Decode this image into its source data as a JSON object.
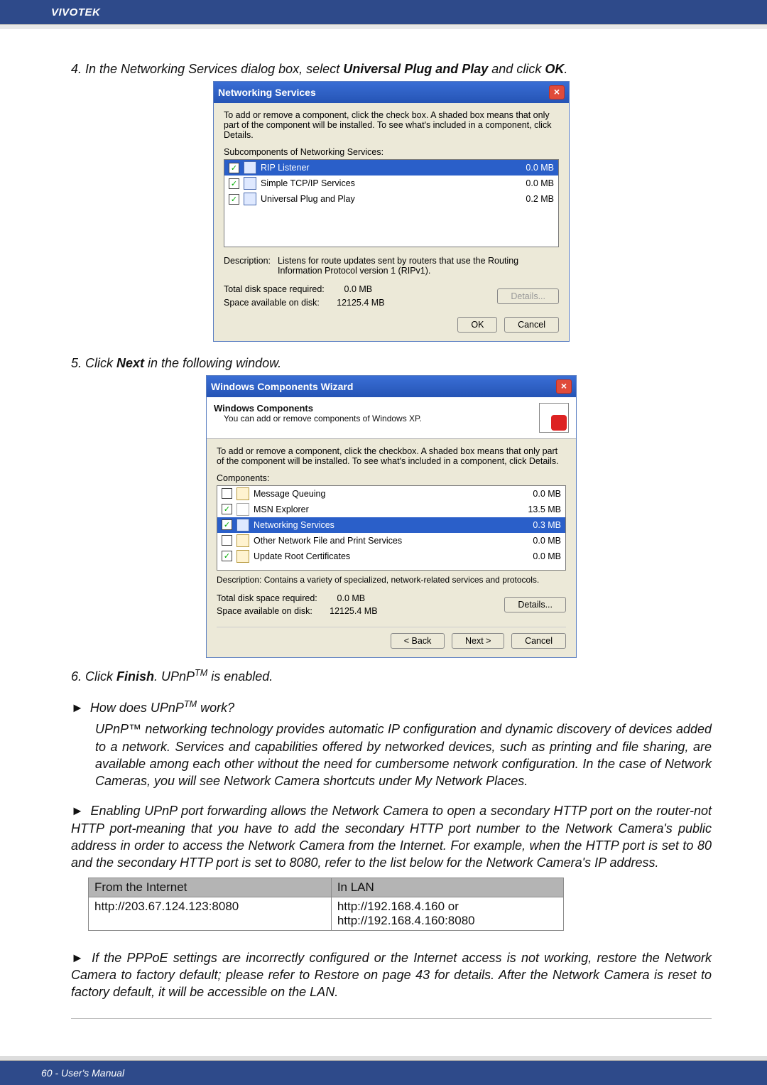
{
  "brand": "VIVOTEK",
  "step4_pre": "4. In the Networking Services dialog box, select ",
  "step4_bold": "Universal Plug and Play",
  "step4_mid": " and click ",
  "step4_ok": "OK",
  "step4_post": ".",
  "dlg1": {
    "title": "Networking Services",
    "instr": "To add or remove a component, click the check box. A shaded box means that only part of the component will be installed. To see what's included in a component, click Details.",
    "sublabel": "Subcomponents of Networking Services:",
    "rows": [
      {
        "name": "RIP Listener",
        "size": "0.0 MB",
        "checked": true,
        "selected": true
      },
      {
        "name": "Simple TCP/IP Services",
        "size": "0.0 MB",
        "checked": true,
        "selected": false
      },
      {
        "name": "Universal Plug and Play",
        "size": "0.2 MB",
        "checked": true,
        "selected": false
      }
    ],
    "desc_label": "Description:",
    "desc_text": "Listens for route updates sent by routers that use the Routing Information Protocol version 1 (RIPv1).",
    "total_label": "Total disk space required:",
    "total_val": "0.0 MB",
    "avail_label": "Space available on disk:",
    "avail_val": "12125.4 MB",
    "details_btn": "Details...",
    "ok_btn": "OK",
    "cancel_btn": "Cancel"
  },
  "step5_pre": "5. Click ",
  "step5_bold": "Next",
  "step5_post": " in the following window.",
  "dlg2": {
    "title": "Windows Components Wizard",
    "head_title": "Windows Components",
    "head_sub": "You can add or remove components of Windows XP.",
    "instr": "To add or remove a component, click the checkbox. A shaded box means that only part of the component will be installed. To see what's included in a component, click Details.",
    "comp_label": "Components:",
    "rows": [
      {
        "name": "Message Queuing",
        "size": "0.0 MB",
        "checked": false
      },
      {
        "name": "MSN Explorer",
        "size": "13.5 MB",
        "checked": true
      },
      {
        "name": "Networking Services",
        "size": "0.3 MB",
        "checked": true,
        "selected": true
      },
      {
        "name": "Other Network File and Print Services",
        "size": "0.0 MB",
        "checked": false
      },
      {
        "name": "Update Root Certificates",
        "size": "0.0 MB",
        "checked": true
      }
    ],
    "desc2": "Description:  Contains a variety of specialized, network-related services and protocols.",
    "total_label": "Total disk space required:",
    "total_val": "0.0 MB",
    "avail_label": "Space available on disk:",
    "avail_val": "12125.4 MB",
    "details_btn": "Details...",
    "back_btn": "< Back",
    "next_btn": "Next >",
    "cancel_btn": "Cancel"
  },
  "step6_pre": "6. Click ",
  "step6_bold": "Finish",
  "step6_post": ". UPnP",
  "step6_tail": " is enabled.",
  "howq_arrow": "►",
  "howq_pre": " How does UPnP",
  "howq_post": " work?",
  "how_body": "UPnP™ networking technology provides automatic IP configuration and dynamic discovery of devices added to a network. Services and capabilities offered by networked devices, such as printing and file sharing, are available among each other without the need for cumbersome network configuration. In the case of Network Cameras, you will see Network Camera shortcuts under My Network Places.",
  "fwd": "Enabling UPnP port forwarding allows the Network Camera to open a secondary HTTP port on the router-not HTTP port-meaning that you have to add the secondary HTTP port number to the Network Camera's public address in order to access the Network Camera from the Internet. For example, when the HTTP port is set to 80 and the secondary HTTP port is set to 8080, refer to the list below for the Network Camera's IP address.",
  "tbl": {
    "h1": "From the Internet",
    "h2": "In LAN",
    "c1": "http://203.67.124.123:8080",
    "c2a": "http://192.168.4.160 or",
    "c2b": "http://192.168.4.160:8080"
  },
  "pppoe": "If the PPPoE settings are incorrectly configured or the Internet access is not working, restore the Network Camera to factory default; please refer to Restore on page 43 for details. After the Network Camera is reset to factory default, it will be accessible on the LAN.",
  "footer": "60 - User's Manual"
}
